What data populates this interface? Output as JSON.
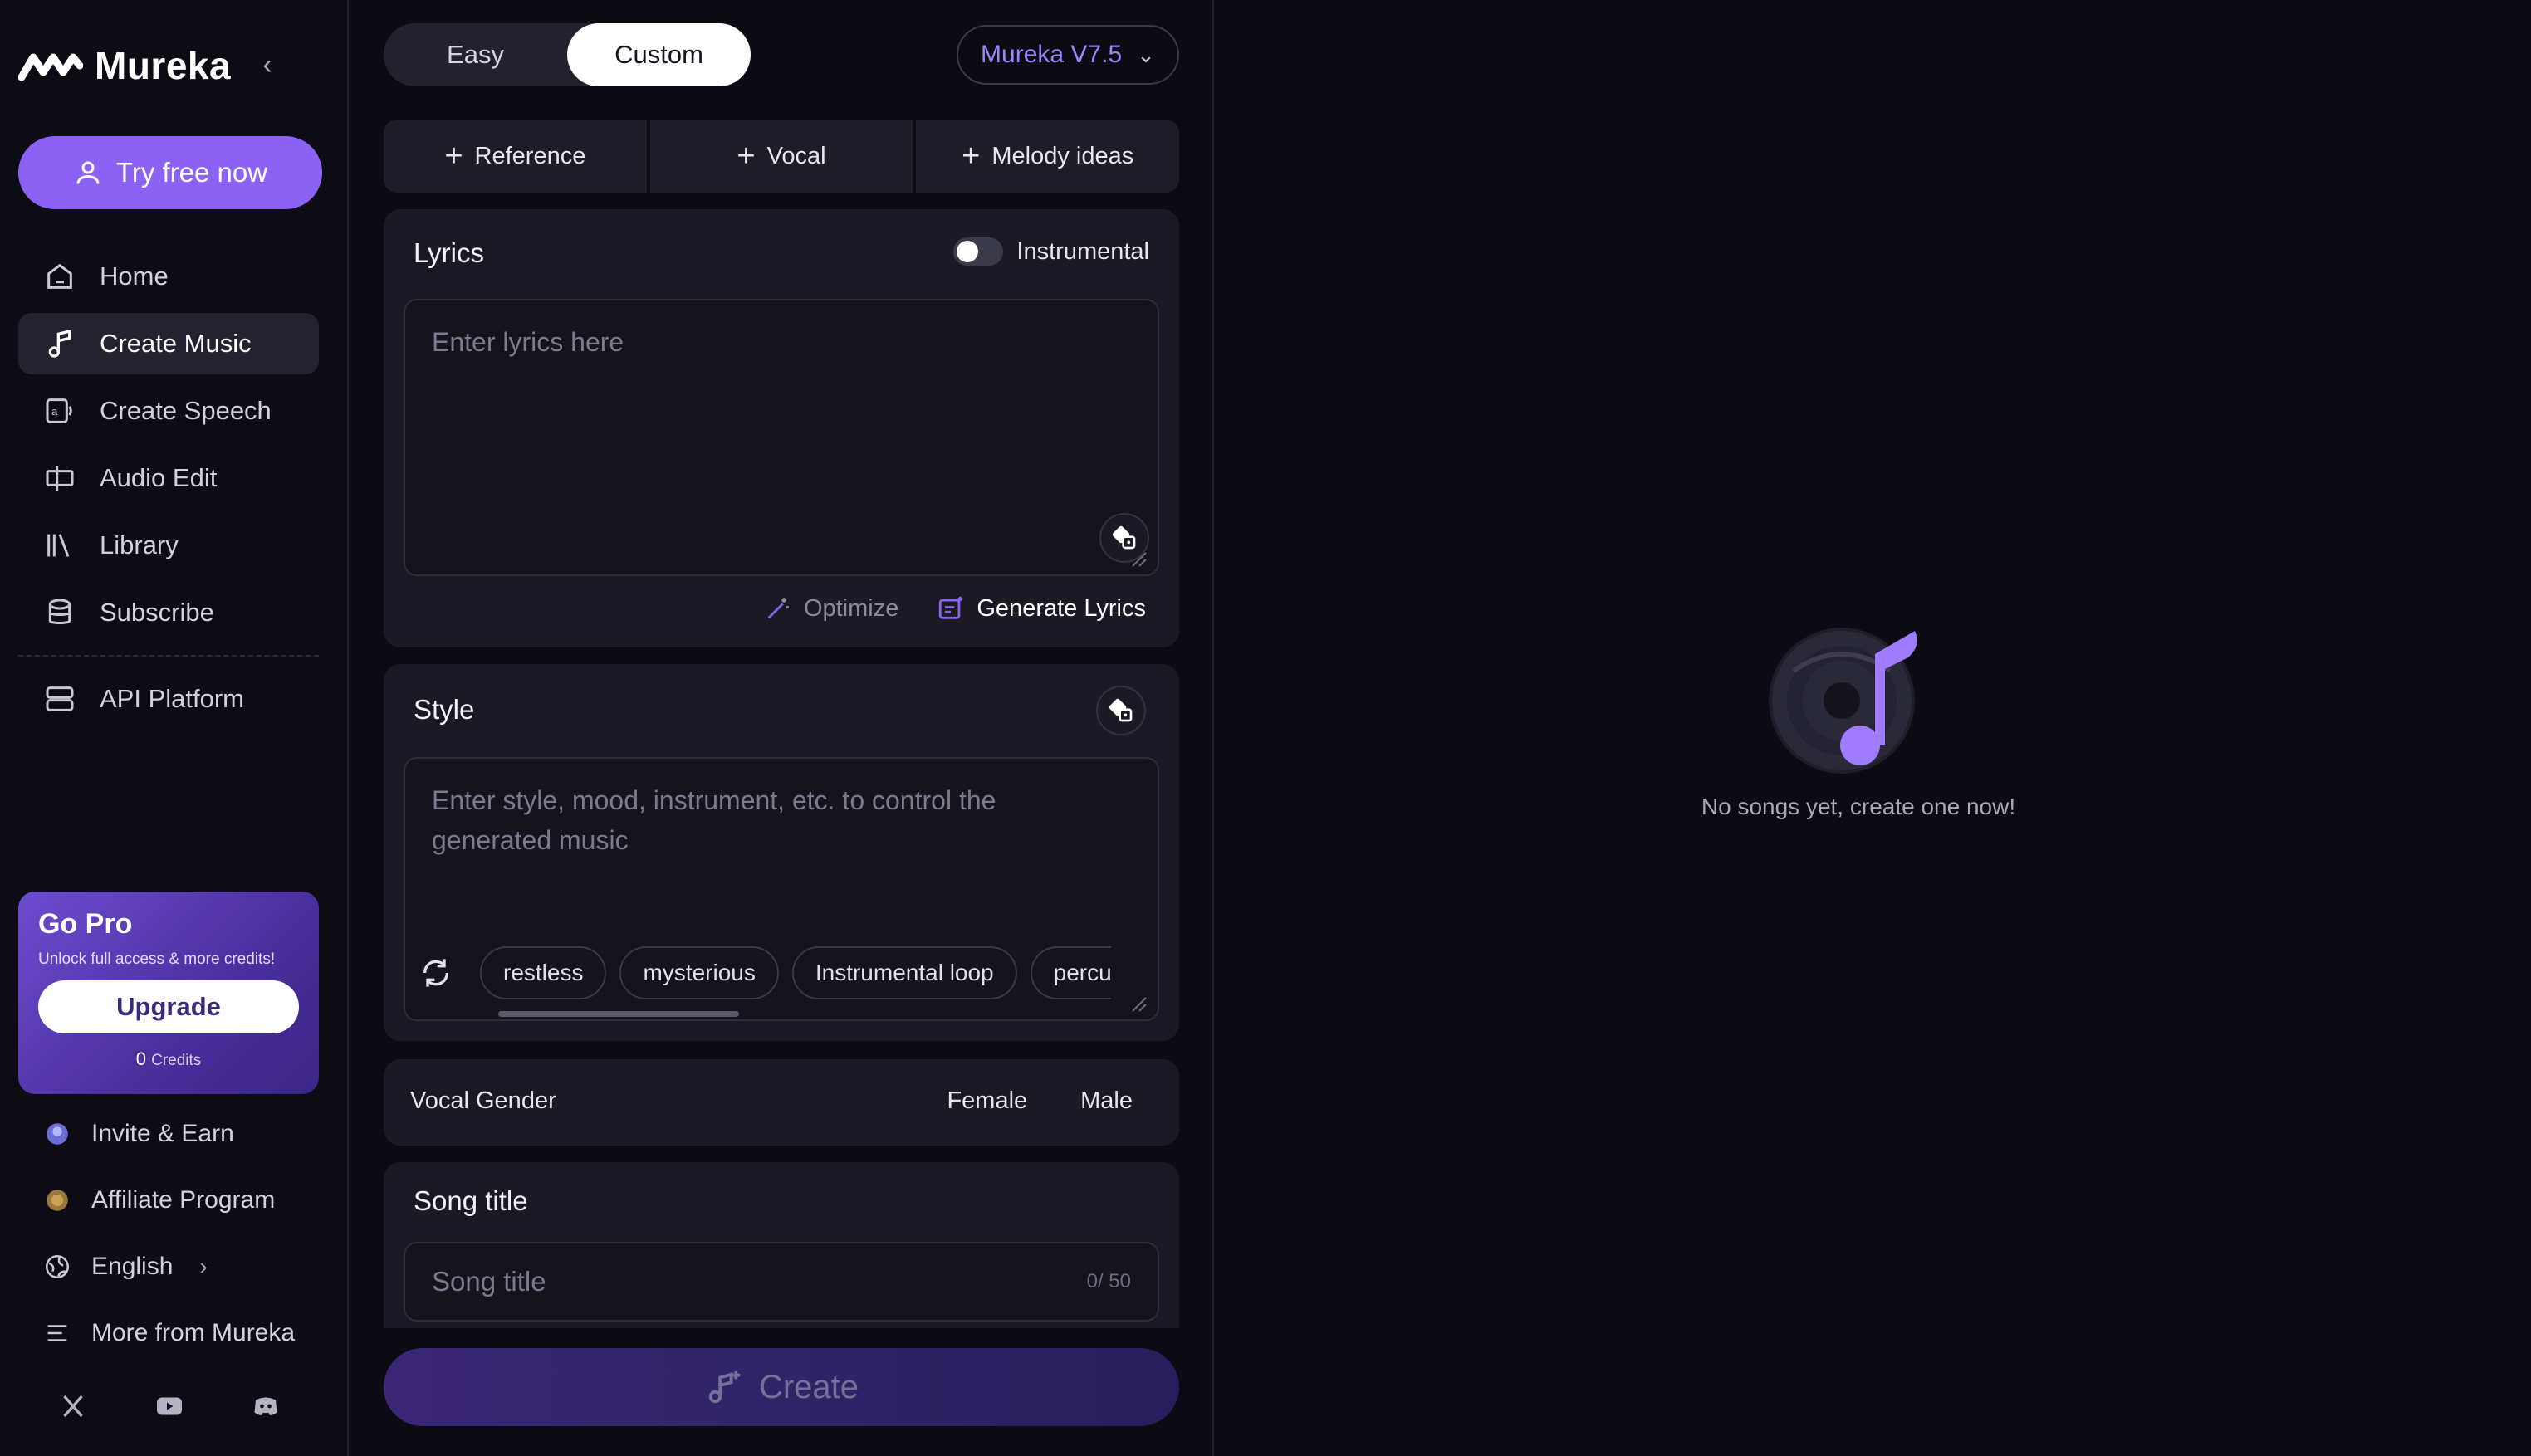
{
  "brand": {
    "name": "Mureka",
    "accent": "#8c62f5"
  },
  "sidebar": {
    "try_label": "Try free now",
    "items": [
      {
        "label": "Home",
        "icon": "home-icon"
      },
      {
        "label": "Create Music",
        "icon": "music-note-icon",
        "active": true
      },
      {
        "label": "Create Speech",
        "icon": "speech-icon"
      },
      {
        "label": "Audio Edit",
        "icon": "audio-edit-icon"
      },
      {
        "label": "Library",
        "icon": "library-icon"
      },
      {
        "label": "Subscribe",
        "icon": "database-icon"
      },
      {
        "label": "API Platform",
        "icon": "server-icon"
      }
    ],
    "gopro": {
      "title": "Go Pro",
      "subtitle": "Unlock full access & more credits!",
      "upgrade_label": "Upgrade",
      "credits_value": "0",
      "credits_label": "Credits"
    },
    "bottom": [
      {
        "label": "Invite & Earn",
        "icon": "invite-icon"
      },
      {
        "label": "Affiliate Program",
        "icon": "coin-icon"
      },
      {
        "label": "English",
        "icon": "globe-icon"
      },
      {
        "label": "More from Mureka",
        "icon": "menu-icon"
      }
    ],
    "social": [
      "x-icon",
      "youtube-icon",
      "discord-icon"
    ]
  },
  "form": {
    "modes": [
      "Easy",
      "Custom"
    ],
    "active_mode": "Custom",
    "model": "Mureka V7.5",
    "add_buttons": [
      "Reference",
      "Vocal",
      "Melody ideas"
    ],
    "lyrics": {
      "title": "Lyrics",
      "instrumental_label": "Instrumental",
      "instrumental_on": false,
      "placeholder": "Enter lyrics here",
      "optimize_label": "Optimize",
      "generate_label": "Generate Lyrics"
    },
    "style": {
      "title": "Style",
      "placeholder": "Enter style, mood, instrument, etc. to control the generated music",
      "tags": [
        "restless",
        "mysterious",
        "Instrumental loop",
        "percu"
      ]
    },
    "vocal_gender": {
      "label": "Vocal Gender",
      "options": [
        "Female",
        "Male"
      ]
    },
    "song_title": {
      "title": "Song title",
      "placeholder": "Song title",
      "count": "0/ 50"
    },
    "create_label": "Create"
  },
  "right": {
    "empty_text": "No songs yet, create one now!"
  }
}
